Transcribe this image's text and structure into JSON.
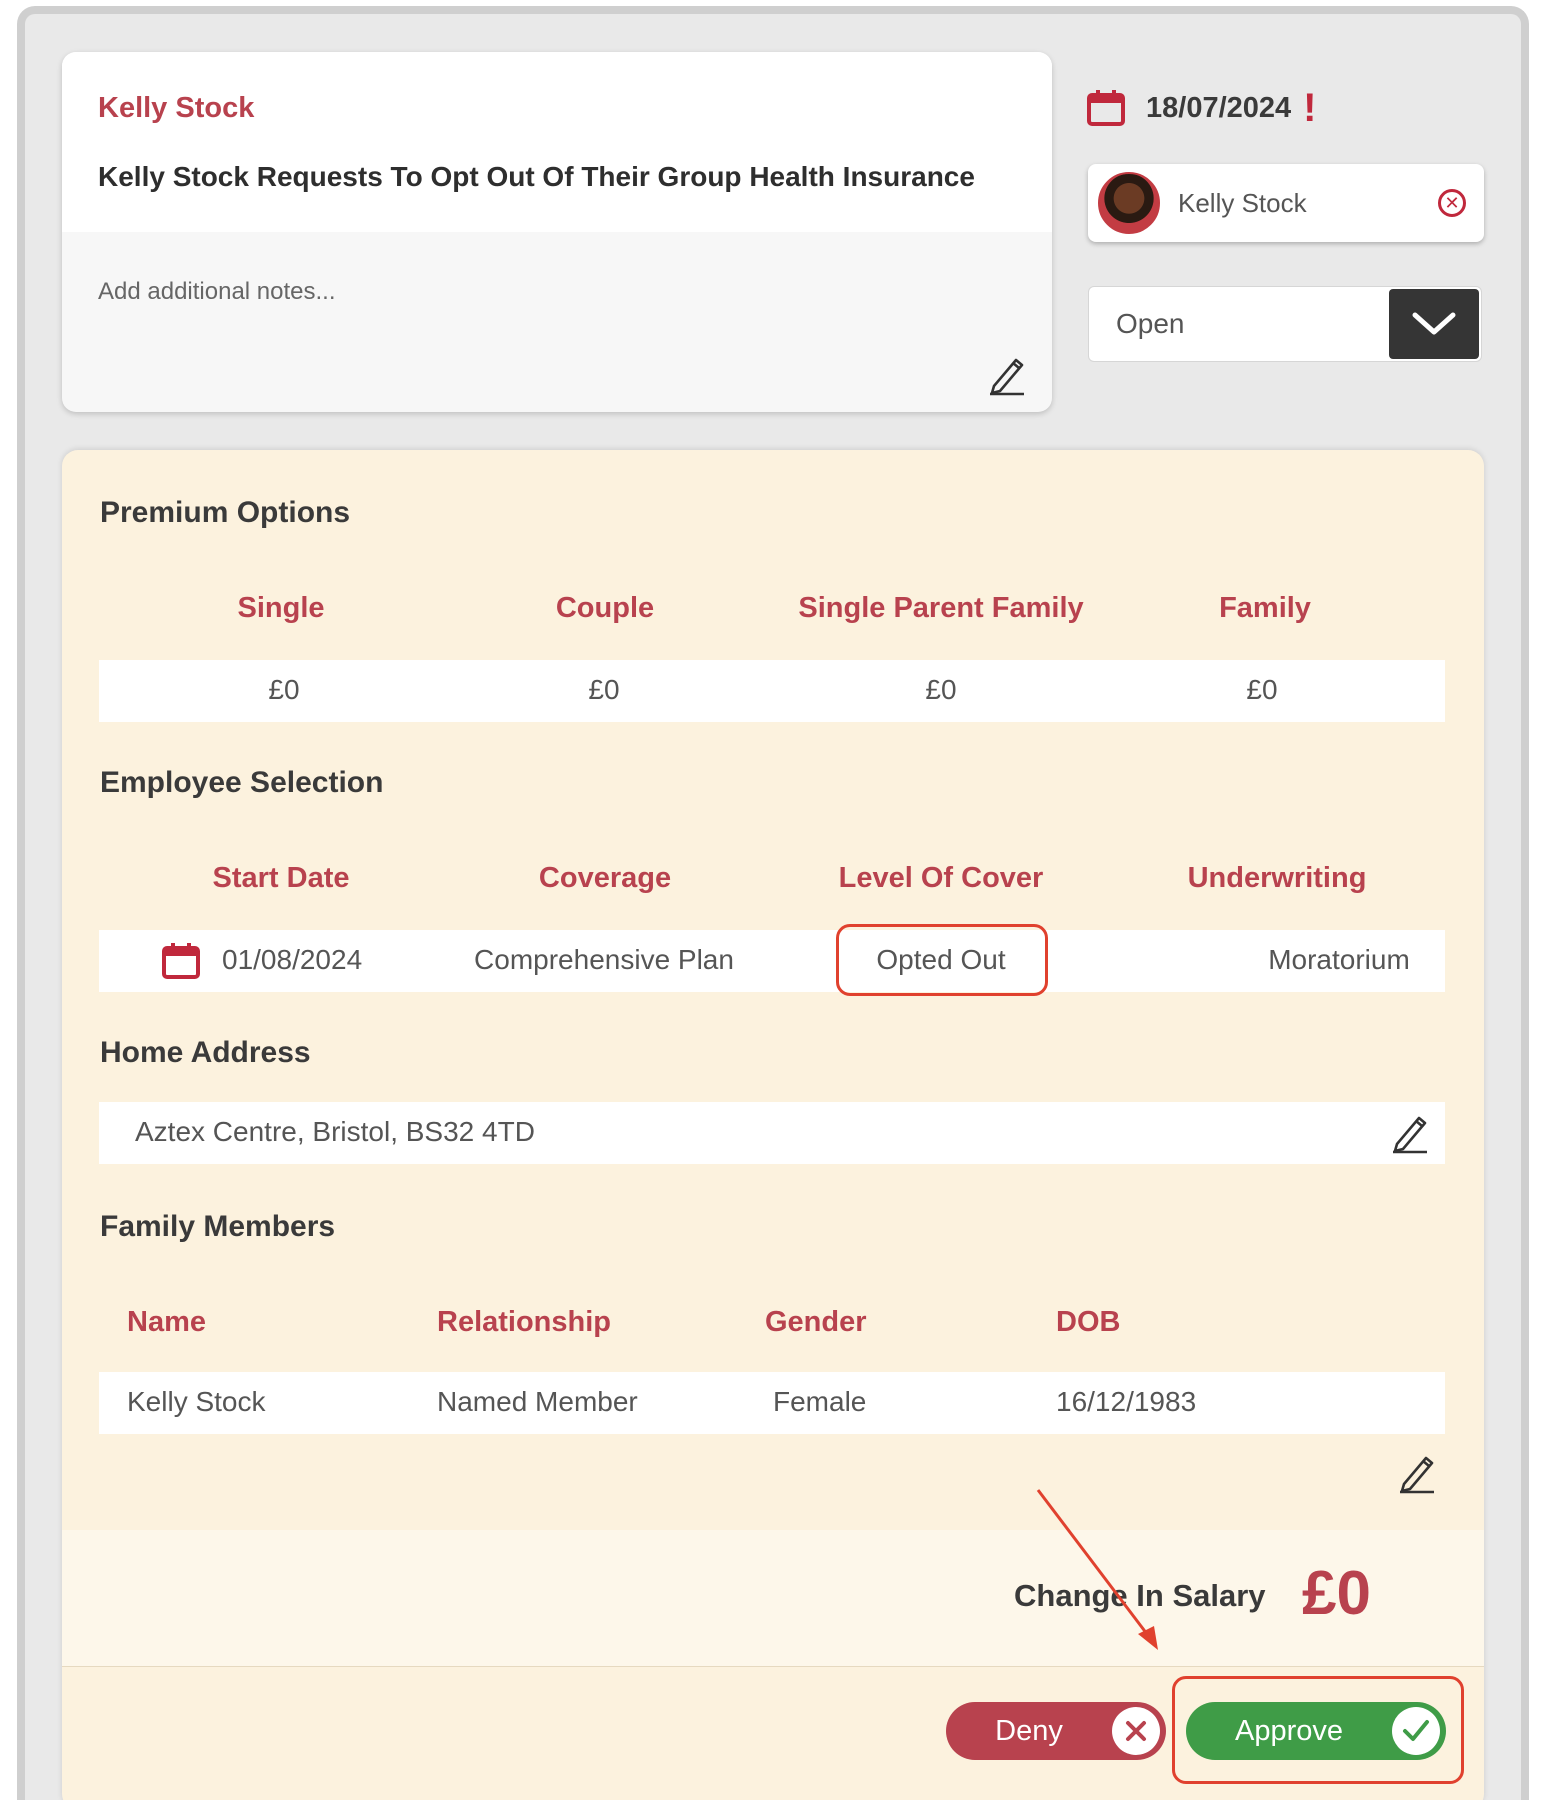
{
  "task": {
    "employee_name": "Kelly Stock",
    "title": "Kelly Stock Requests To Opt Out Of Their Group Health Insurance",
    "notes_placeholder": "Add additional notes..."
  },
  "sidebar": {
    "date": "18/07/2024",
    "alert": "!",
    "assignee": "Kelly Stock",
    "status": "Open"
  },
  "premium_options": {
    "heading": "Premium Options",
    "columns": [
      "Single",
      "Couple",
      "Single Parent Family",
      "Family"
    ],
    "values": [
      "£0",
      "£0",
      "£0",
      "£0"
    ]
  },
  "employee_selection": {
    "heading": "Employee Selection",
    "columns": [
      "Start Date",
      "Coverage",
      "Level Of Cover",
      "Underwriting"
    ],
    "start_date": "01/08/2024",
    "coverage": "Comprehensive Plan",
    "level_of_cover": "Opted Out",
    "underwriting": "Moratorium"
  },
  "home_address": {
    "heading": "Home Address",
    "value": "Aztex Centre, Bristol, BS32 4TD"
  },
  "family_members": {
    "heading": "Family Members",
    "columns": [
      "Name",
      "Relationship",
      "Gender",
      "DOB"
    ],
    "rows": [
      {
        "name": "Kelly Stock",
        "relationship": "Named Member",
        "gender": "Female",
        "dob": "16/12/1983"
      }
    ]
  },
  "salary": {
    "label": "Change In Salary",
    "value": "£0"
  },
  "actions": {
    "deny": "Deny",
    "approve": "Approve"
  },
  "colors": {
    "accent": "#b8424e",
    "approve": "#3f9c47",
    "highlight": "#e0412e",
    "panel": "#fcf2de"
  }
}
